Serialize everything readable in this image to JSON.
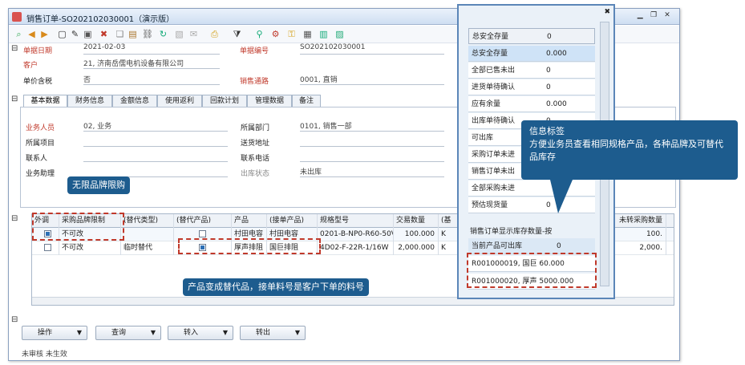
{
  "window": {
    "title": "销售订单-SO202102030001（演示版）",
    "controls": [
      "▁",
      "❐",
      "✕"
    ]
  },
  "toolbar": {
    "icons": [
      "search-icon",
      "back-icon",
      "forward-icon",
      "new-icon",
      "edit-icon",
      "save-icon",
      "delete-icon",
      "copy-icon",
      "paste-icon",
      "link-icon",
      "refresh-icon",
      "attach-icon",
      "mail-icon",
      "print-icon",
      "filter-icon",
      "find-icon",
      "settings-icon",
      "lock-icon",
      "report-icon",
      "excel-icon",
      "export-icon"
    ]
  },
  "header": {
    "doc_date_label": "单据日期",
    "doc_date": "2021-02-03",
    "doc_no_label": "单据编号",
    "doc_no": "SO202102030001",
    "customer_label": "客户",
    "customer": "21, 济南岳儒电机设备有限公司",
    "tax_label": "单价含税",
    "tax": "否",
    "channel_label": "销售通路",
    "channel": "0001, 直销"
  },
  "tabs": [
    "基本数据",
    "财务信息",
    "金额信息",
    "使用返利",
    "回款计划",
    "管理数据",
    "备注"
  ],
  "basic": {
    "salesman_label": "业务人员",
    "salesman": "02, 业务",
    "dept_label": "所属部门",
    "dept": "0101, 销售一部",
    "project_label": "所属项目",
    "ship_addr_label": "送货地址",
    "contact_label": "联系人",
    "phone_label": "联系电话",
    "assistant_label": "业务助理",
    "ship_status_label": "出库状态",
    "ship_status": "未出库"
  },
  "grid": {
    "headers": [
      "外调",
      "采购品牌限制",
      "(替代类型)",
      "(替代产品)",
      "产品",
      "(接单产品)",
      "规格型号",
      "交易数量",
      "(基",
      "未转采购数量"
    ],
    "rows": [
      {
        "ext": true,
        "brand": "不可改",
        "type": "",
        "sub": false,
        "product": "村田电容",
        "order_product": "村田电容",
        "spec": "0201-B-NP0-R60-50V",
        "qty": "100.000",
        "unit": "K",
        "unconv": "100."
      },
      {
        "ext": false,
        "brand": "不可改",
        "type": "临时替代",
        "sub": true,
        "product": "厚声排阻",
        "order_product": "国巨排阻",
        "spec": "4D02-F-22R-1/16W",
        "qty": "2,000.000",
        "unit": "K",
        "unconv": "2,000."
      }
    ]
  },
  "buttons": [
    {
      "label": "操作"
    },
    {
      "label": "查询"
    },
    {
      "label": "转入"
    },
    {
      "label": "转出"
    }
  ],
  "status": "未审核 未生效",
  "popup": {
    "title_key": "总安全存量",
    "title_val": "0",
    "rows": [
      {
        "k": "总安全存量",
        "v": "0.000"
      },
      {
        "k": "全部已售未出",
        "v": "0"
      },
      {
        "k": "进货单待确认",
        "v": "0"
      },
      {
        "k": "应有余量",
        "v": "0.000"
      },
      {
        "k": "出库单待确认",
        "v": "0"
      },
      {
        "k": "可出库",
        "v": ""
      },
      {
        "k": "采购订单未进",
        "v": ""
      },
      {
        "k": "销售订单未出",
        "v": ""
      },
      {
        "k": "全部采购未进",
        "v": ""
      },
      {
        "k": "预估现货量",
        "v": "0"
      }
    ],
    "footer_title": "销售订单显示库存数量-按",
    "current_label": "当前产品可出库",
    "current_val": "0",
    "stock1": "R001000019, 国巨 60.000",
    "stock2": "R001000020, 厚声 5000.000"
  },
  "callouts": {
    "brand": "无限品牌限购",
    "sub": "产品变成替代品，接单料号是客户下单的料号",
    "info_title": "信息标签",
    "info_body": "方便业务员查看相同规格产品，各种品牌及可替代品库存"
  }
}
